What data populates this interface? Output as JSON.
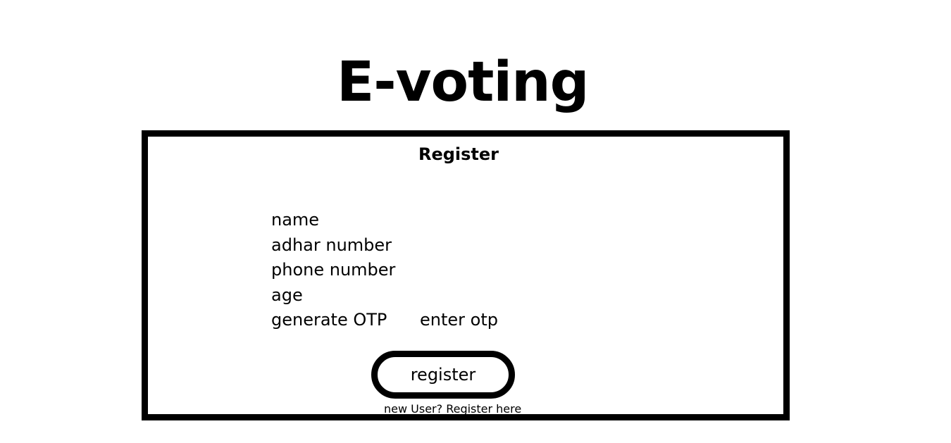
{
  "header": {
    "title": "E-voting"
  },
  "register_card": {
    "title": "Register",
    "fields": {
      "name": "name",
      "adhar_number": "adhar number",
      "phone_number": "phone number",
      "age": "age",
      "generate_otp": "generate OTP",
      "enter_otp": "enter otp"
    },
    "register_button": "register",
    "new_user_link": "new User? Register here"
  },
  "colors": {
    "background": "#ffffff",
    "foreground": "#000000"
  }
}
